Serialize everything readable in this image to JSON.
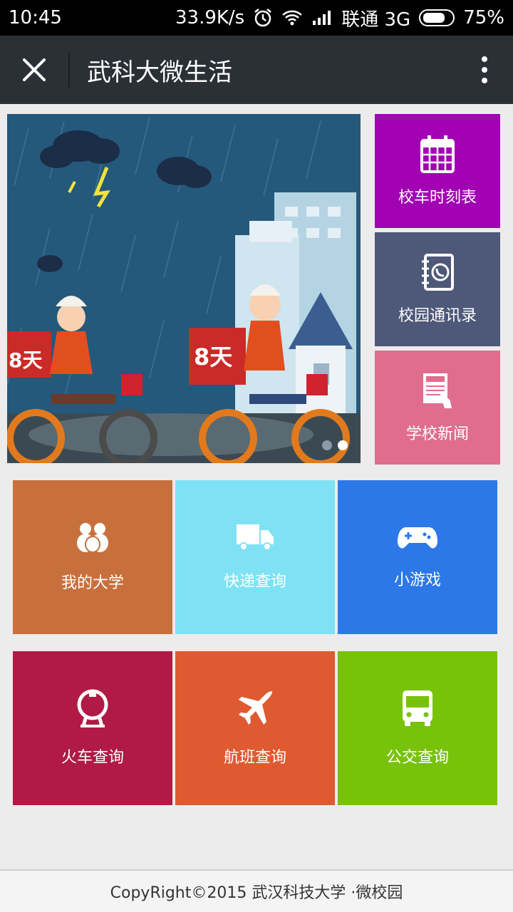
{
  "status_bar": {
    "time": "10:45",
    "speed": "33.9K/s",
    "carrier": "联通 3G",
    "battery": "75%",
    "icons": [
      "alarm-icon",
      "wifi-icon",
      "signal-icon",
      "battery-icon"
    ]
  },
  "title_bar": {
    "title": "武科大微生活",
    "close_icon": "close-icon",
    "more_icon": "more-vertical-icon"
  },
  "banner": {
    "slide_count": 2,
    "active_slide": 2,
    "texts": [
      "8天",
      "8天"
    ]
  },
  "side_tiles": [
    {
      "label": "校车时刻表",
      "icon": "calendar-icon",
      "color": "#a100b3"
    },
    {
      "label": "校园通讯录",
      "icon": "address-book-icon",
      "color": "#4e5878"
    },
    {
      "label": "学校新闻",
      "icon": "news-icon",
      "color": "#e06c8e"
    }
  ],
  "grid_tiles": [
    {
      "label": "我的大学",
      "icon": "people-icon",
      "color": "#c8703d"
    },
    {
      "label": "快递查询",
      "icon": "truck-icon",
      "color": "#7ee2f4"
    },
    {
      "label": "小游戏",
      "icon": "gamepad-icon",
      "color": "#2c78e8"
    },
    {
      "label": "火车查询",
      "icon": "railway-icon",
      "color": "#b01a45"
    },
    {
      "label": "航班查询",
      "icon": "airplane-icon",
      "color": "#df5a30"
    },
    {
      "label": "公交查询",
      "icon": "bus-icon",
      "color": "#78c20c"
    }
  ],
  "footer": {
    "copyright": "CopyRight©2015 武汉科技大学 ·微校园"
  }
}
